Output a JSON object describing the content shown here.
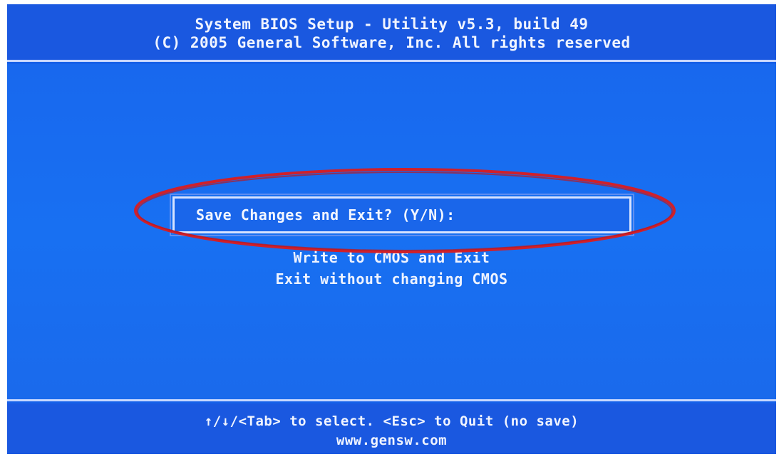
{
  "header": {
    "title": "System BIOS Setup - Utility v5.3, build 49",
    "copyright": "(C) 2005 General Software, Inc. All rights reserved"
  },
  "dialog": {
    "prompt": "Save Changes and Exit? (Y/N):"
  },
  "options": [
    {
      "label": "Write to CMOS and Exit"
    },
    {
      "label": "Exit without changing CMOS"
    }
  ],
  "footer": {
    "help": "↑/↓/<Tab> to select.  <Esc> to Quit (no save)",
    "website": "www.gensw.com"
  },
  "colors": {
    "background": "#1560e8",
    "text": "#e8f0ff",
    "annotation": "#d0202a"
  }
}
